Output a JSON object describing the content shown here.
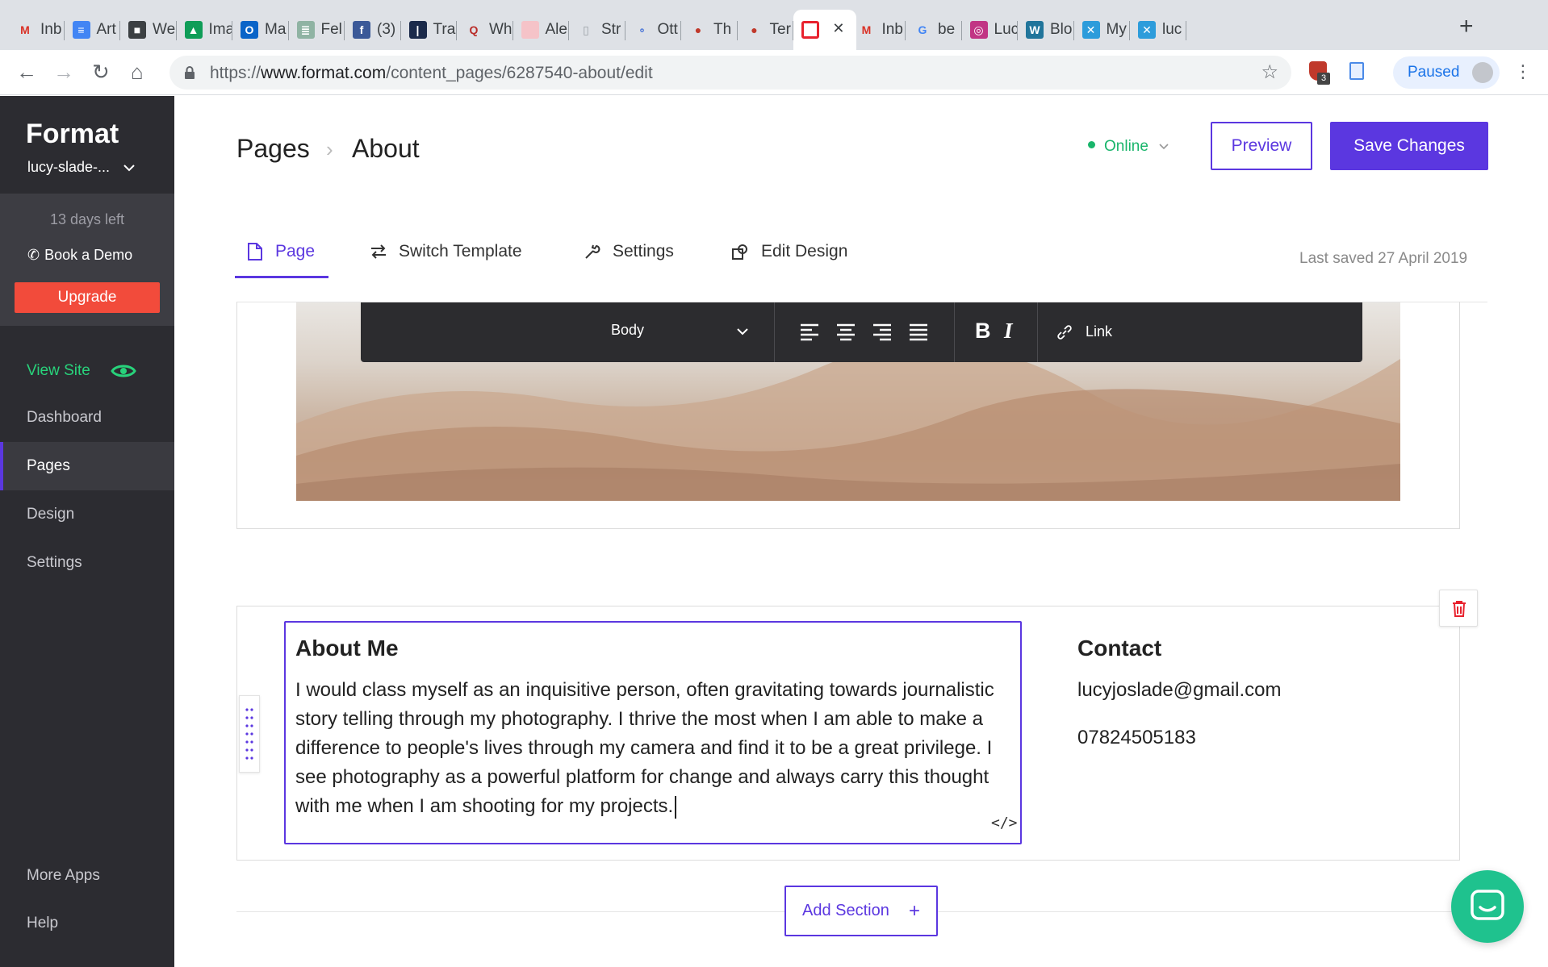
{
  "browser": {
    "tabs": [
      {
        "title": "Inb",
        "icon": "gmail-icon",
        "color": "#d93025",
        "glyph": "M"
      },
      {
        "title": "Art",
        "icon": "docs-icon",
        "color": "#4285f4",
        "glyph": "≡"
      },
      {
        "title": "We",
        "icon": "cube-icon",
        "color": "#3c4043",
        "glyph": "■"
      },
      {
        "title": "Ima",
        "icon": "drive-icon",
        "color": "#0f9d58",
        "glyph": "▲"
      },
      {
        "title": "Ma",
        "icon": "outlook-icon",
        "color": "#0a64c8",
        "glyph": "O"
      },
      {
        "title": "Fel",
        "icon": "page-icon",
        "color": "#8fb3a3",
        "glyph": "≣"
      },
      {
        "title": "(3)",
        "icon": "facebook-icon",
        "color": "#3b5998",
        "glyph": "f"
      },
      {
        "title": "Tra",
        "icon": "audio-icon",
        "color": "#1b2a4a",
        "glyph": "|"
      },
      {
        "title": "Wh",
        "icon": "quora-icon",
        "color": "#b92b27",
        "glyph": "Q"
      },
      {
        "title": "Ale",
        "icon": "blank-pink-icon",
        "color": "#f5c3c8",
        "glyph": ""
      },
      {
        "title": "Str",
        "icon": "document-icon",
        "color": "#9aa0a6",
        "glyph": "▯"
      },
      {
        "title": "Ott",
        "icon": "otter-icon",
        "color": "#3667d6",
        "glyph": "∘"
      },
      {
        "title": "Th",
        "icon": "apple-icon",
        "color": "#c0392b",
        "glyph": "●"
      },
      {
        "title": "Ter",
        "icon": "apple-icon",
        "color": "#c0392b",
        "glyph": "●"
      },
      {
        "title": "",
        "icon": "format-icon",
        "color": "#e8212d",
        "glyph": "□",
        "active": true
      },
      {
        "title": "Inb",
        "icon": "gmail-icon",
        "color": "#d93025",
        "glyph": "M"
      },
      {
        "title": "be",
        "icon": "google-icon",
        "color": "#4285f4",
        "glyph": "G"
      },
      {
        "title": "Luc",
        "icon": "instagram-icon",
        "color": "#c13584",
        "glyph": "◎"
      },
      {
        "title": "Blo",
        "icon": "wordpress-icon",
        "color": "#21759b",
        "glyph": "W"
      },
      {
        "title": "My",
        "icon": "x-icon",
        "color": "#2d9cdb",
        "glyph": "✕"
      },
      {
        "title": "luc",
        "icon": "x-icon",
        "color": "#2d9cdb",
        "glyph": "✕"
      }
    ],
    "url_scheme": "https://",
    "url_host": "www.format.com",
    "url_path": "/content_pages/6287540-about/edit",
    "extension_badge": "3",
    "profile_label": "Paused"
  },
  "sidebar": {
    "brand": "Format",
    "site_name": "lucy-slade-...",
    "trial_text": "13 days left",
    "demo_label": "Book a Demo",
    "upgrade_label": "Upgrade",
    "view_site_label": "View Site",
    "nav": [
      "Dashboard",
      "Pages",
      "Design",
      "Settings"
    ],
    "active_nav": "Pages",
    "bottom": [
      "More Apps",
      "Help"
    ]
  },
  "header": {
    "crumb_root": "Pages",
    "crumb_current": "About",
    "status": "Online",
    "preview_label": "Preview",
    "save_label": "Save Changes"
  },
  "tabs": {
    "page": "Page",
    "switch_template": "Switch Template",
    "settings": "Settings",
    "edit_design": "Edit Design",
    "last_saved": "Last saved 27 April 2019"
  },
  "format_bar": {
    "style_value": "Body",
    "bold": "B",
    "italic": "I",
    "link_label": "Link"
  },
  "about": {
    "title": "About Me",
    "body": "I would class myself as an inquisitive person, often gravitating towards journalistic story telling through my photography. I thrive the most when I am able to make a difference to people's lives through my camera and find it to be a great privilege. I see photography as a powerful platform for change and always carry this thought with me when I am shooting for my projects.",
    "code_glyph": "</>"
  },
  "contact": {
    "title": "Contact",
    "email": "lucyjoslade@gmail.com",
    "phone": "07824505183"
  },
  "add_section_label": "Add Section",
  "colors": {
    "accent": "#5b37e0",
    "sidebar_bg": "#2c2c31",
    "upgrade": "#f24b3b",
    "online": "#19b56b",
    "chat": "#1fc28e"
  }
}
